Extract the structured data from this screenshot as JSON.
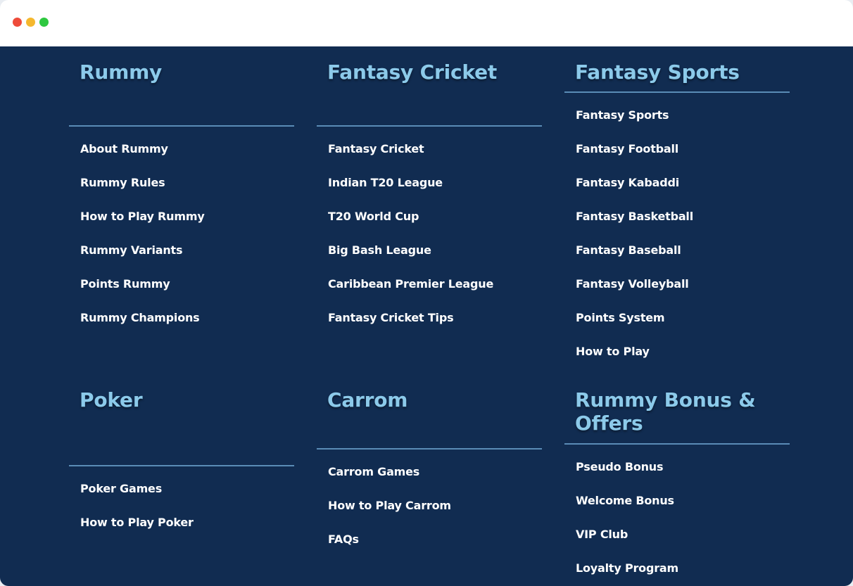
{
  "sections": [
    {
      "title": "Rummy",
      "links": [
        "About Rummy",
        "Rummy Rules",
        "How to Play Rummy",
        "Rummy Variants",
        "Points Rummy",
        "Rummy Champions"
      ]
    },
    {
      "title": "Fantasy Cricket",
      "links": [
        "Fantasy Cricket",
        "Indian T20 League",
        "T20 World Cup",
        "Big Bash League",
        "Caribbean Premier League",
        "Fantasy Cricket Tips"
      ]
    },
    {
      "title": "Fantasy Sports",
      "links": [
        "Fantasy Sports",
        "Fantasy Football",
        "Fantasy Kabaddi",
        "Fantasy Basketball",
        "Fantasy Baseball",
        "Fantasy Volleyball",
        "Points System",
        "How to Play"
      ]
    },
    {
      "title": "Poker",
      "links": [
        "Poker Games",
        "How to Play Poker"
      ]
    },
    {
      "title": "Carrom",
      "links": [
        "Carrom Games",
        "How to Play Carrom",
        "FAQs"
      ]
    },
    {
      "title": "Rummy Bonus & Offers",
      "links": [
        "Pseudo Bonus",
        "Welcome Bonus",
        "VIP Club",
        "Loyalty Program"
      ]
    }
  ],
  "colors": {
    "background": "#112c51",
    "heading": "#8ccaea",
    "divider": "#5a8cb6",
    "link": "#ffffff"
  }
}
